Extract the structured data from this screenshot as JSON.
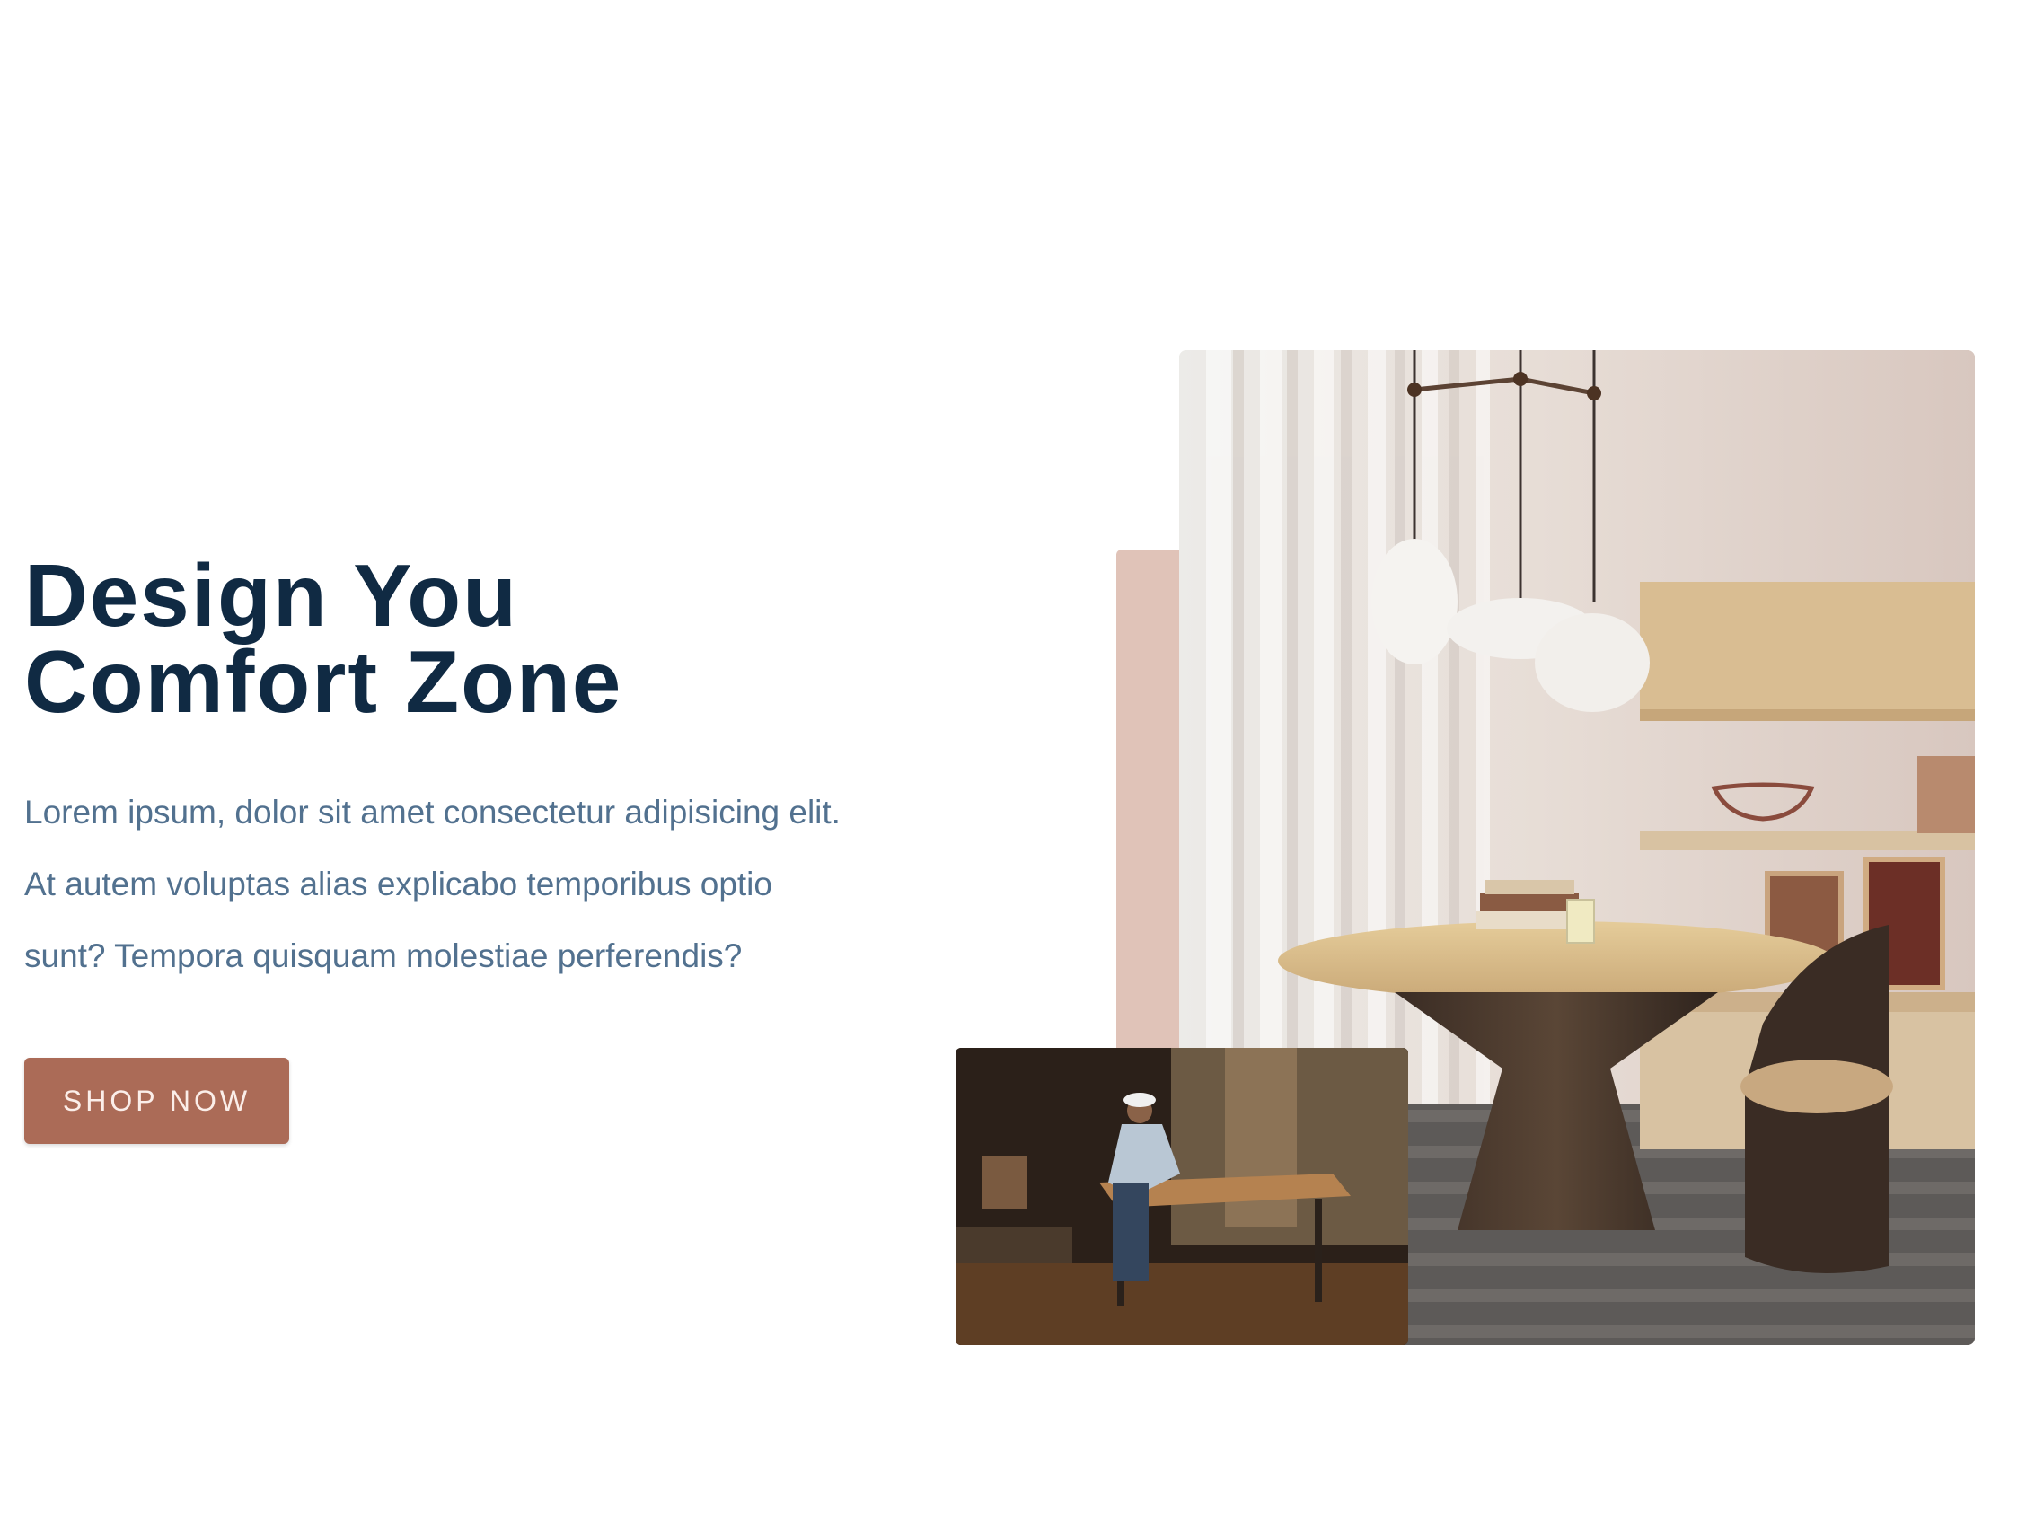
{
  "hero": {
    "title_line1": "Design You",
    "title_line2": "Comfort Zone",
    "description_lines": [
      "Lorem ipsum, dolor sit amet consectetur adipisicing elit.",
      "At autem voluptas alias explicabo temporibus optio",
      "sunt? Tempora quisquam molestiae perferendis?"
    ],
    "cta_label": "Shop Now"
  },
  "images": {
    "main": "dining-room-interior-image",
    "secondary": "carpenter-workshop-image"
  },
  "colors": {
    "title": "#102a43",
    "text": "#52718f",
    "button": "#ab6b57",
    "accent": "#e0c3b8"
  }
}
